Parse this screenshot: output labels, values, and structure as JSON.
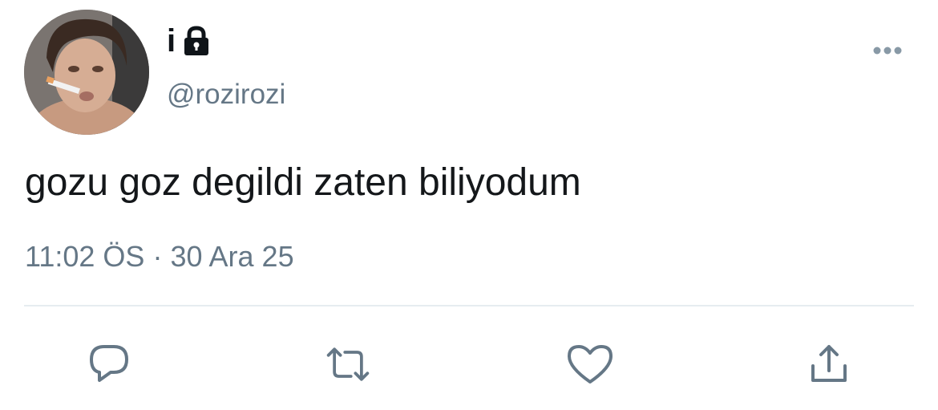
{
  "tweet": {
    "display_name": "i",
    "handle": "@rozirozi",
    "text": "gozu goz degildi zaten biliyodum",
    "time": "11:02 ÖS",
    "separator": "·",
    "date": "30 Ara 25"
  },
  "icons": {
    "lock": "lock-icon",
    "more": "more-dots-icon",
    "reply": "reply-icon",
    "retweet": "retweet-icon",
    "like": "heart-icon",
    "share": "share-icon"
  },
  "colors": {
    "text": "#14171a",
    "secondary": "#657786",
    "divider": "#e6ecf0"
  }
}
